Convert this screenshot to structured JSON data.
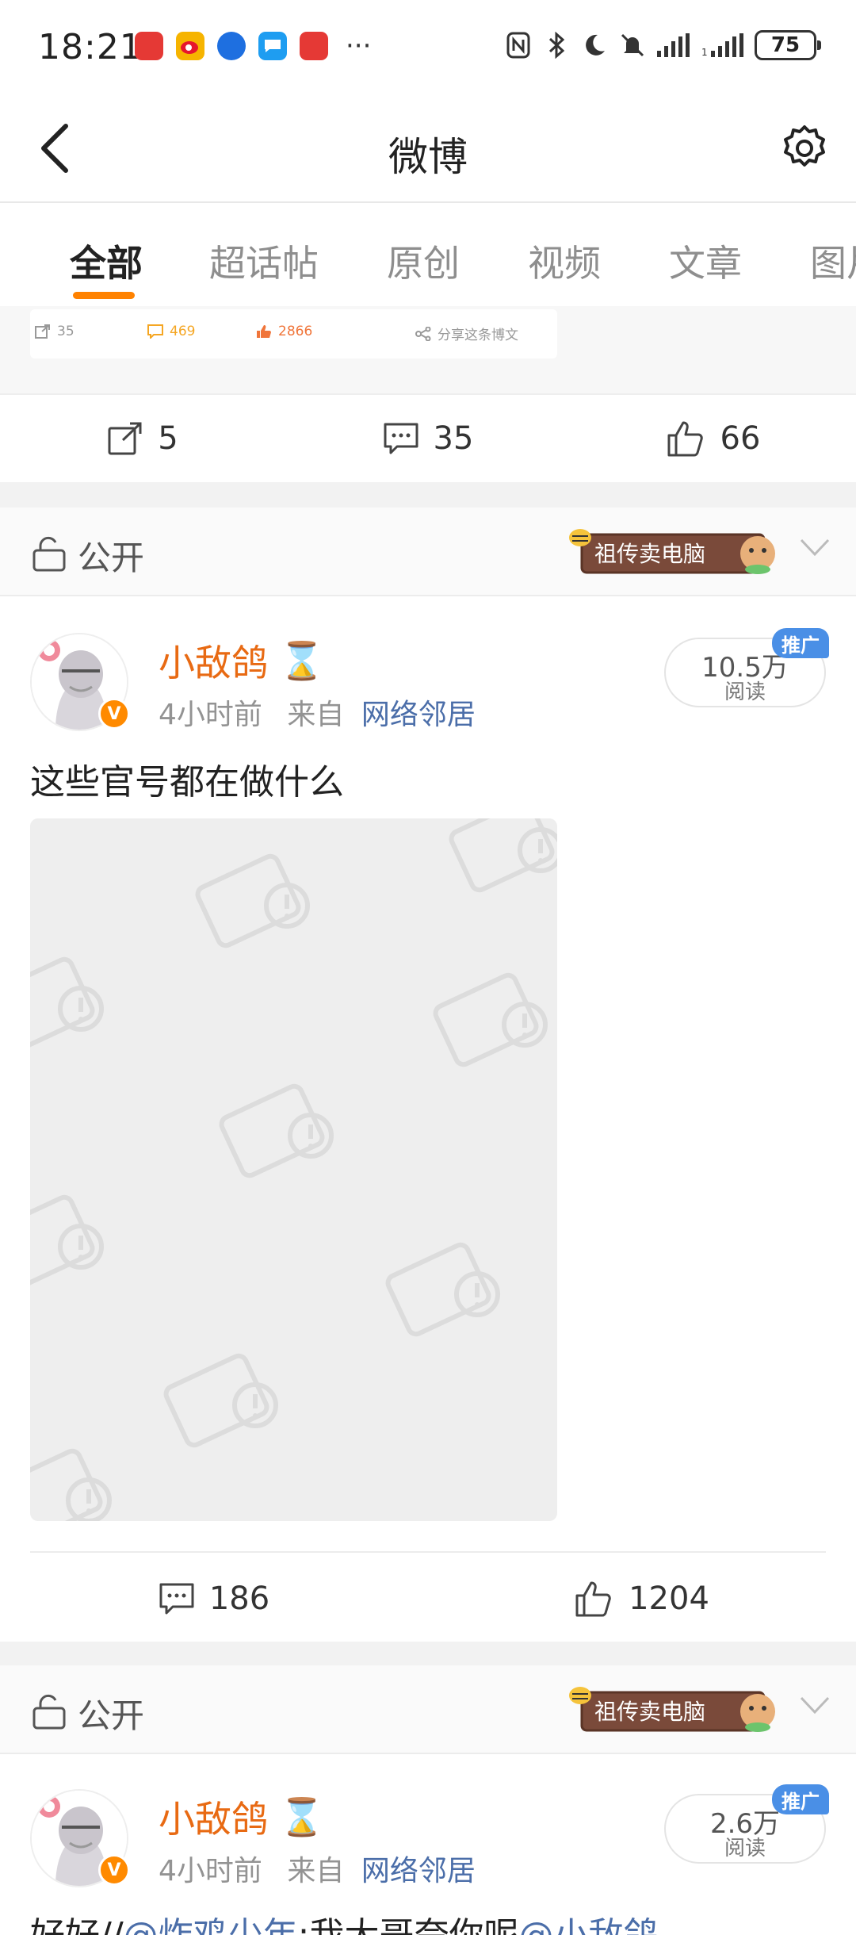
{
  "status_bar": {
    "time": "18:21",
    "more": "···",
    "battery": "75",
    "app_colors": [
      "#e53935",
      "#f6b400",
      "#1e6fe0",
      "#1e9df1",
      "#e53935"
    ]
  },
  "nav": {
    "title": "微博"
  },
  "tabs": [
    {
      "label": "全部",
      "active": true
    },
    {
      "label": "超话帖"
    },
    {
      "label": "原创"
    },
    {
      "label": "视频"
    },
    {
      "label": "文章"
    },
    {
      "label": "图片"
    }
  ],
  "prev_post": {
    "card": {
      "repost": "35",
      "comment": "469",
      "like": "2866",
      "share": "分享这条博文"
    },
    "actions": {
      "repost": "5",
      "comment": "35",
      "like": "66"
    }
  },
  "posts": [
    {
      "visibility": "公开",
      "ad_badge": "祖传卖电脑",
      "author": "小敌鸽",
      "author_emoji": "⌛",
      "time": "4小时前",
      "source_prefix": "来自",
      "source": "网络邻居",
      "reads": "10.5万",
      "reads_label": "阅读",
      "promo": "推广",
      "text": "这些官号都在做什么",
      "actions": {
        "comment": "186",
        "like": "1204"
      }
    },
    {
      "visibility": "公开",
      "ad_badge": "祖传卖电脑",
      "author": "小敌鸽",
      "author_emoji": "⌛",
      "time": "4小时前",
      "source_prefix": "来自",
      "source": "网络邻居",
      "reads": "2.6万",
      "reads_label": "阅读",
      "promo": "推广",
      "text_prefix": "好好//",
      "text_mention1": "@炸鸡少年",
      "text_middle": ":我大哥夸你呢",
      "text_mention2": "@小敌鸽"
    }
  ],
  "colors": {
    "accent": "#ff8200",
    "username": "#e86a13",
    "link": "#4b6ea9"
  }
}
